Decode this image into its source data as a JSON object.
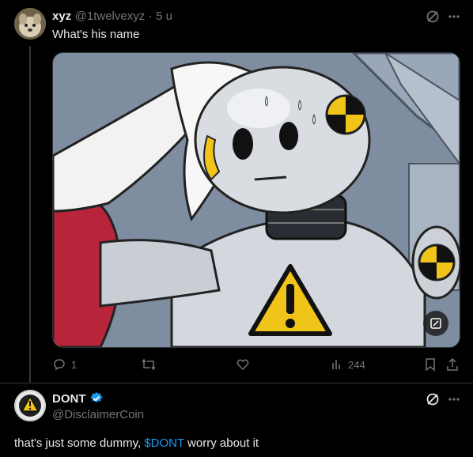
{
  "tweet1": {
    "display_name": "xyz",
    "handle": "@1twelvexyz",
    "separator": "·",
    "time": "5 u",
    "text": "What's his name",
    "actions": {
      "replies": "1",
      "retweets": "",
      "likes": "",
      "views": "244"
    }
  },
  "tweet2": {
    "display_name": "DONT",
    "handle": "@DisclaimerCoin",
    "text_before": "that's just some dummy, ",
    "cashtag": "$DONT",
    "text_after": " worry about it"
  },
  "colors": {
    "background": "#000000",
    "text": "#e7e9ea",
    "muted": "#71767b",
    "link": "#1d9bf0",
    "verified": "#1d9bf0"
  }
}
